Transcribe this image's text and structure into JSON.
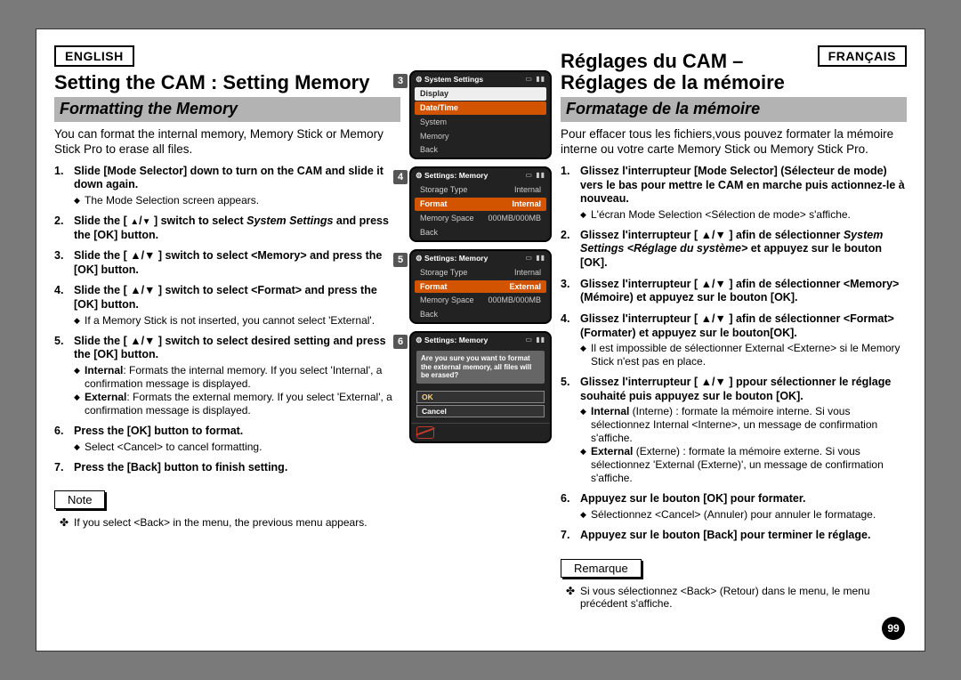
{
  "page_number": "99",
  "en": {
    "lang": "ENGLISH",
    "h1": "Setting the CAM : Setting Memory",
    "subtitle": "Formatting the Memory",
    "intro": "You can format the internal memory, Memory Stick or Memory Stick Pro to erase all files.",
    "steps": [
      {
        "n": "1.",
        "bold": "Slide [Mode Selector] down to turn on the CAM and slide it down again.",
        "subs": [
          "The Mode Selection screen appears."
        ]
      },
      {
        "n": "2.",
        "html": "<span class='b'>Slide the [ <span class='arrow'>▲</span>/<span class='arrow'>▼</span> ] switch to select </span><span class='b i'>System Settings</span><span class='b'> and press the [OK] button.</span>"
      },
      {
        "n": "3.",
        "bold": "Slide the [ ▲/▼ ] switch to select <Memory> and press the [OK] button."
      },
      {
        "n": "4.",
        "bold": "Slide the [ ▲/▼ ] switch to select <Format> and press the [OK] button.",
        "subs": [
          "If a Memory Stick is not inserted, you cannot select 'External'."
        ]
      },
      {
        "n": "5.",
        "bold": "Slide the [ ▲/▼ ] switch to select desired setting and press the [OK] button.",
        "subs": [
          "Internal: Formats the internal memory. If you select  'Internal', a confirmation message is displayed.",
          "External: Formats the external memory. If you select 'External', a confirmation message is displayed."
        ],
        "subbold": [
          "Internal",
          "External"
        ]
      },
      {
        "n": "6.",
        "bold": "Press the [OK] button to format.",
        "subs": [
          "Select <Cancel> to cancel formatting."
        ]
      },
      {
        "n": "7.",
        "bold": "Press the [Back] button to finish setting."
      }
    ],
    "note_label": "Note",
    "note": "If you select <Back> in the menu, the previous menu appears."
  },
  "fr": {
    "lang": "FRANÇAIS",
    "h1a": "Réglages du CAM –",
    "h1b": "Réglages de la mémoire",
    "subtitle": "Formatage de la mémoire",
    "intro": "Pour effacer tous les fichiers,vous pouvez formater la mémoire interne ou votre carte Memory Stick ou Memory Stick Pro.",
    "steps": [
      {
        "n": "1.",
        "bold": "Glissez l'interrupteur [Mode Selector] (Sélecteur de mode) vers le bas pour mettre le CAM en marche puis actionnez-le à nouveau.",
        "subs": [
          "L'écran Mode Selection <Sélection de mode> s'affiche."
        ]
      },
      {
        "n": "2.",
        "html": "<span class='b'>Glissez l'interrupteur [ ▲/▼ ] afin de sélectionner </span><span class='b i'>System Settings &lt;Réglage du système&gt;</span><span class='b'> et appuyez sur le bouton [OK].</span>"
      },
      {
        "n": "3.",
        "bold": "Glissez l'interrupteur [ ▲/▼ ] afin de sélectionner <Memory> (Mémoire) et appuyez sur le bouton [OK]."
      },
      {
        "n": "4.",
        "bold": "Glissez l'interrupteur [ ▲/▼ ] afin de sélectionner <Format> (Formater) et appuyez sur le bouton[OK].",
        "subs": [
          "Il est impossible de sélectionner External <Externe> si le Memory Stick n'est pas en place."
        ]
      },
      {
        "n": "5.",
        "bold": "Glissez l'interrupteur [ ▲/▼ ] ppour sélectionner le réglage souhaité puis appuyez sur le bouton [OK].",
        "subs": [
          "Internal (Interne) : formate la mémoire interne. Si vous sélectionnez Internal <Interne>, un message de confirmation s'affiche.",
          "External (Externe) : formate la mémoire externe. Si vous sélectionnez 'External (Externe)', un message de confirmation s'affiche."
        ],
        "subbold": [
          "Internal",
          "External"
        ]
      },
      {
        "n": "6.",
        "bold": "Appuyez sur le bouton [OK] pour formater.",
        "subs": [
          "Sélectionnez <Cancel> (Annuler) pour annuler le formatage."
        ]
      },
      {
        "n": "7.",
        "bold": "Appuyez sur le bouton [Back] pour terminer le réglage."
      }
    ],
    "note_label": "Remarque",
    "note": "Si vous sélectionnez <Back> (Retour) dans le menu, le menu précédent s'affiche."
  },
  "lcds": [
    {
      "num": "3",
      "title": "System Settings",
      "rows": [
        {
          "k": "Display",
          "cls": "wbox"
        },
        {
          "k": "Date/Time",
          "cls": "sel"
        },
        {
          "k": "System",
          "cls": ""
        },
        {
          "k": "Memory",
          "cls": ""
        },
        {
          "k": "Back",
          "cls": ""
        }
      ]
    },
    {
      "num": "4",
      "title": "Settings: Memory",
      "rows": [
        {
          "k": "Storage Type",
          "v": "Internal",
          "cls": ""
        },
        {
          "k": "Format",
          "v": "Internal",
          "cls": "sel"
        },
        {
          "k": "Memory Space",
          "v": "000MB/000MB",
          "cls": ""
        },
        {
          "k": "Back",
          "cls": ""
        }
      ]
    },
    {
      "num": "5",
      "title": "Settings: Memory",
      "rows": [
        {
          "k": "Storage Type",
          "v": "Internal",
          "cls": ""
        },
        {
          "k": "Format",
          "v": "External",
          "cls": "sel"
        },
        {
          "k": "Memory Space",
          "v": "000MB/000MB",
          "cls": ""
        },
        {
          "k": "Back",
          "cls": ""
        }
      ]
    },
    {
      "num": "6",
      "title": "Settings: Memory",
      "popup": "Are you sure you want to format the external memory, all files will be erased?",
      "btns": [
        "OK",
        "Cancel"
      ],
      "status": true
    }
  ]
}
